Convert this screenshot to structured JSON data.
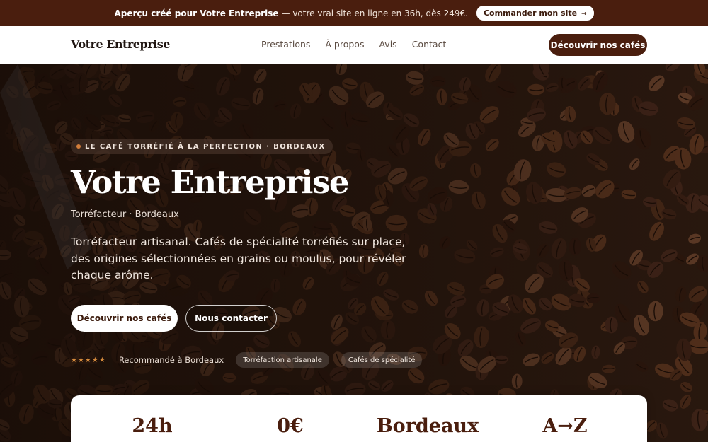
{
  "banner": {
    "strong_text": "Aperçu créé pour Votre Entreprise",
    "text": "— votre vrai site en ligne en 36h, dès 249€.",
    "cta_label": "Commander mon site",
    "cta_arrow": "→"
  },
  "nav": {
    "brand": "Votre Entreprise",
    "items": [
      "Prestations",
      "À propos",
      "Avis",
      "Contact"
    ],
    "cta_label": "Découvrir nos cafés"
  },
  "hero": {
    "kicker": "LE CAFÉ TORRÉFIÉ À LA PERFECTION · BORDEAUX",
    "title": "Votre Entreprise",
    "subtitle": "Torréfacteur · Bordeaux",
    "description": "Torréfacteur artisanal. Cafés de spécialité torréfiés sur place, des origines sélectionnées en grains ou moulus, pour révéler chaque arôme.",
    "primary_label": "Découvrir nos cafés",
    "secondary_label": "Nous contacter",
    "stars": "★★★★★",
    "rating_label": "Recommandé à Bordeaux",
    "tags": [
      "Torréfaction artisanale",
      "Cafés de spécialité"
    ]
  },
  "stats": [
    "24h",
    "0€",
    "Bordeaux",
    "A→Z"
  ],
  "colors": {
    "brand": "#4a1e0e",
    "accent": "#d48a3c"
  }
}
